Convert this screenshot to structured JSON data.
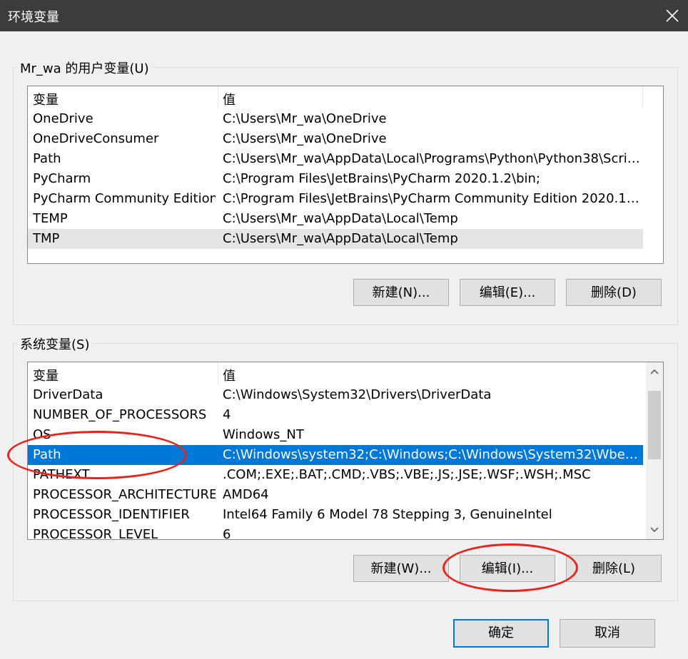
{
  "window": {
    "title": "环境变量"
  },
  "user_vars": {
    "group_label": "Mr_wa 的用户变量(U)",
    "columns": [
      "变量",
      "值"
    ],
    "rows": [
      {
        "name": "OneDrive",
        "value": "C:\\Users\\Mr_wa\\OneDrive"
      },
      {
        "name": "OneDriveConsumer",
        "value": "C:\\Users\\Mr_wa\\OneDrive"
      },
      {
        "name": "Path",
        "value": "C:\\Users\\Mr_wa\\AppData\\Local\\Programs\\Python\\Python38\\Scrip..."
      },
      {
        "name": "PyCharm",
        "value": "C:\\Program Files\\JetBrains\\PyCharm 2020.1.2\\bin;"
      },
      {
        "name": "PyCharm Community Edition",
        "value": "C:\\Program Files\\JetBrains\\PyCharm Community Edition 2020.1.2\\..."
      },
      {
        "name": "TEMP",
        "value": "C:\\Users\\Mr_wa\\AppData\\Local\\Temp"
      },
      {
        "name": "TMP",
        "value": "C:\\Users\\Mr_wa\\AppData\\Local\\Temp"
      }
    ],
    "buttons": {
      "new": "新建(N)...",
      "edit": "编辑(E)...",
      "delete": "删除(D)"
    }
  },
  "system_vars": {
    "group_label": "系统变量(S)",
    "columns": [
      "变量",
      "值"
    ],
    "rows": [
      {
        "name": "DriverData",
        "value": "C:\\Windows\\System32\\Drivers\\DriverData"
      },
      {
        "name": "NUMBER_OF_PROCESSORS",
        "value": "4"
      },
      {
        "name": "OS",
        "value": "Windows_NT"
      },
      {
        "name": "Path",
        "value": "C:\\Windows\\system32;C:\\Windows;C:\\Windows\\System32\\Wbem;..."
      },
      {
        "name": "PATHEXT",
        "value": ".COM;.EXE;.BAT;.CMD;.VBS;.VBE;.JS;.JSE;.WSF;.WSH;.MSC"
      },
      {
        "name": "PROCESSOR_ARCHITECTURE",
        "value": "AMD64"
      },
      {
        "name": "PROCESSOR_IDENTIFIER",
        "value": "Intel64 Family 6 Model 78 Stepping 3, GenuineIntel"
      },
      {
        "name": "PROCESSOR_LEVEL",
        "value": "6"
      }
    ],
    "buttons": {
      "new": "新建(W)...",
      "edit": "编辑(I)...",
      "delete": "删除(L)"
    }
  },
  "footer": {
    "ok": "确定",
    "cancel": "取消"
  },
  "colors": {
    "selection": "#0078d7",
    "annotation": "#e8241c",
    "titlebar": "#3c3c3c"
  }
}
